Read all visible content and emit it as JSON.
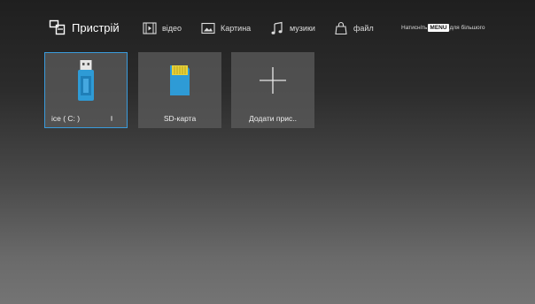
{
  "header": {
    "tabs": [
      {
        "id": "device",
        "label": "Пристрій",
        "icon": "device-icon",
        "active": true
      },
      {
        "id": "video",
        "label": "відео",
        "icon": "video-icon",
        "active": false
      },
      {
        "id": "picture",
        "label": "Картина",
        "icon": "picture-icon",
        "active": false
      },
      {
        "id": "music",
        "label": "музики",
        "icon": "music-note-icon",
        "active": false
      },
      {
        "id": "file",
        "label": "файл",
        "icon": "file-bag-icon",
        "active": false
      }
    ],
    "hint": {
      "prefix": "Натисніть",
      "key": "MENU",
      "suffix": "для більшого"
    }
  },
  "devices": [
    {
      "label": "ice ( C: )",
      "icon": "usb-drive-icon",
      "selected": true
    },
    {
      "label": "SD-карта",
      "icon": "sd-card-icon",
      "selected": false
    },
    {
      "label": "Додати прис..",
      "icon": "plus-icon",
      "selected": false
    }
  ],
  "colors": {
    "accent": "#3a9bdc",
    "usb_body": "#2e9bd6",
    "sd_body": "#2e9bd6",
    "sd_contacts": "#e7d23a"
  }
}
